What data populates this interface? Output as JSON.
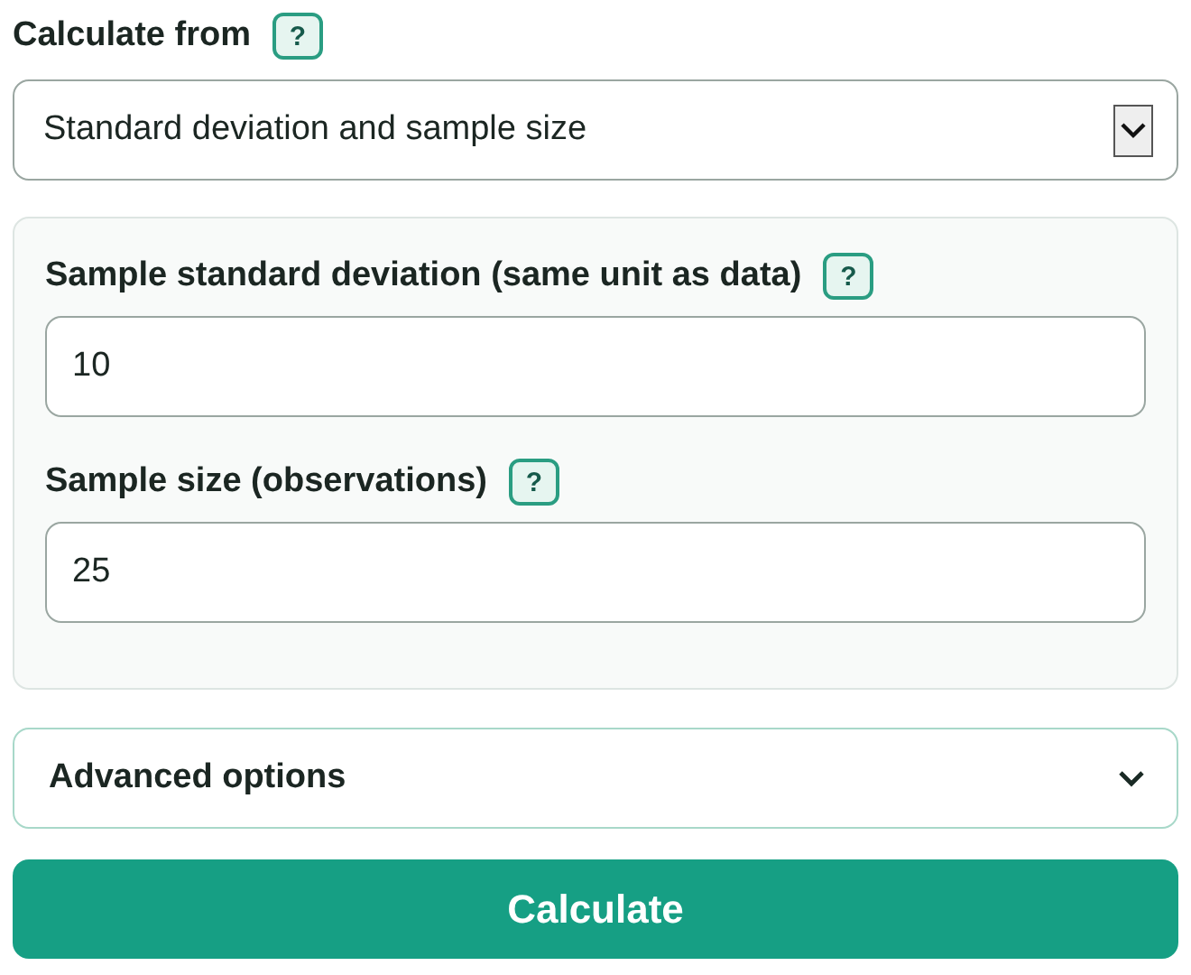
{
  "calculate_from": {
    "label": "Calculate from",
    "help": "?",
    "value": "Standard deviation and sample size"
  },
  "fields": [
    {
      "label": "Sample standard deviation (same unit as data)",
      "help": "?",
      "value": "10"
    },
    {
      "label": "Sample size (observations)",
      "help": "?",
      "value": "25"
    }
  ],
  "advanced": {
    "label": "Advanced options",
    "expanded": false
  },
  "button": "Calculate"
}
